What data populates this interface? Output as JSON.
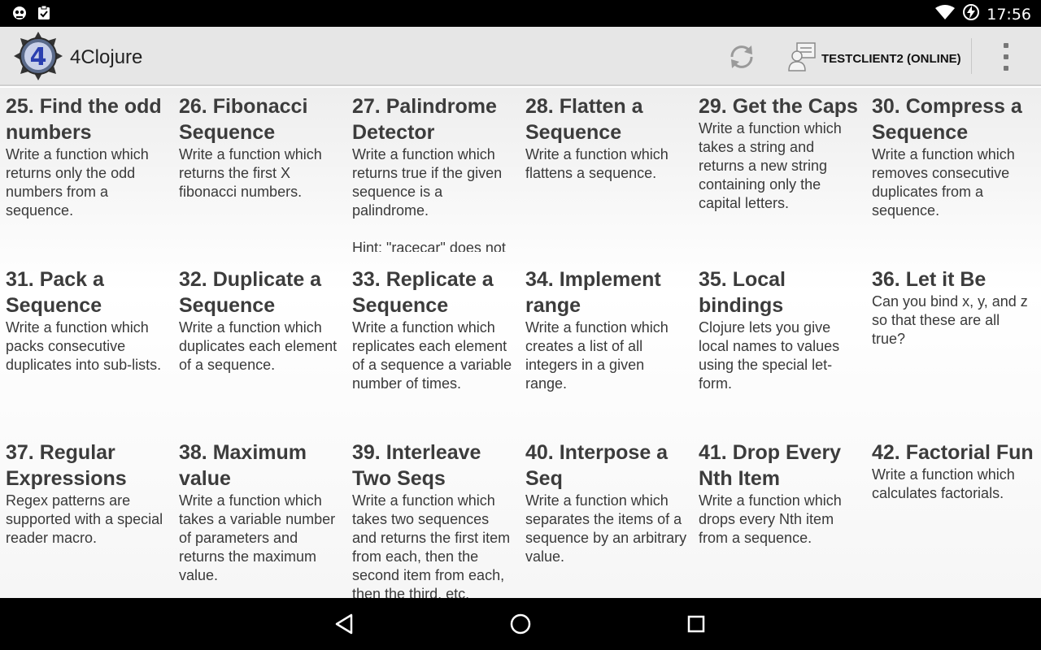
{
  "status_bar": {
    "time": "17:56",
    "icons": [
      "cat-notification-icon",
      "clipboard-check-icon",
      "wifi-icon",
      "battery-charging-icon"
    ]
  },
  "action_bar": {
    "app_title": "4Clojure",
    "logo_text": "4",
    "client_label": "TESTCLIENT2 (ONLINE)",
    "icons": [
      "app-logo",
      "sync-icon",
      "client-user-icon",
      "overflow-menu-icon"
    ]
  },
  "problems": [
    {
      "title": "25. Find the odd numbers",
      "description": "Write a function which returns only the odd numbers from a sequence."
    },
    {
      "title": "26. Fibonacci Sequence",
      "description": "Write a function which returns the first X fibonacci numbers."
    },
    {
      "title": "27. Palindrome Detector",
      "description": "Write a function which returns true if the given sequence is a palindrome.\n\nHint: \"racecar\" does not"
    },
    {
      "title": "28. Flatten a Sequence",
      "description": "Write a function which flattens a sequence."
    },
    {
      "title": "29. Get the Caps",
      "description": "Write a function which takes a string and returns a new string containing only the capital letters."
    },
    {
      "title": "30. Compress a Sequence",
      "description": "Write a function which removes consecutive duplicates from a sequence."
    },
    {
      "title": "31. Pack a Sequence",
      "description": "Write a function which packs consecutive duplicates into sub-lists."
    },
    {
      "title": "32. Duplicate a Sequence",
      "description": "Write a function which duplicates each element of a sequence."
    },
    {
      "title": "33. Replicate a Sequence",
      "description": "Write a function which replicates each element of a sequence a variable number of times."
    },
    {
      "title": "34. Implement range",
      "description": "Write a function which creates a list of all integers in a given range."
    },
    {
      "title": "35. Local bindings",
      "description": "Clojure lets you give local names to values using the special let-form."
    },
    {
      "title": "36. Let it Be",
      "description": "Can you bind x, y, and z so that these are all true?"
    },
    {
      "title": "37. Regular Expressions",
      "description": "Regex patterns are supported with a special reader macro."
    },
    {
      "title": "38. Maximum value",
      "description": "Write a function which takes a variable number of parameters and returns the maximum value."
    },
    {
      "title": "39. Interleave Two Seqs",
      "description": "Write a function which takes two sequences and returns the first item from each, then the second item from each, then the third, etc."
    },
    {
      "title": "40. Interpose a Seq",
      "description": "Write a function which separates the items of a sequence by an arbitrary value."
    },
    {
      "title": "41. Drop Every Nth Item",
      "description": "Write a function which drops every Nth item from a sequence."
    },
    {
      "title": "42. Factorial Fun",
      "description": "Write a function which calculates factorials."
    }
  ],
  "nav_bar": {
    "icons": [
      "back-icon",
      "home-icon",
      "recents-icon"
    ]
  },
  "colors": {
    "status_bar_bg": "#000000",
    "action_bar_bg": "#e6e6e6",
    "title_text": "#3c3c3c",
    "logo_blue": "#2a3fb0"
  }
}
